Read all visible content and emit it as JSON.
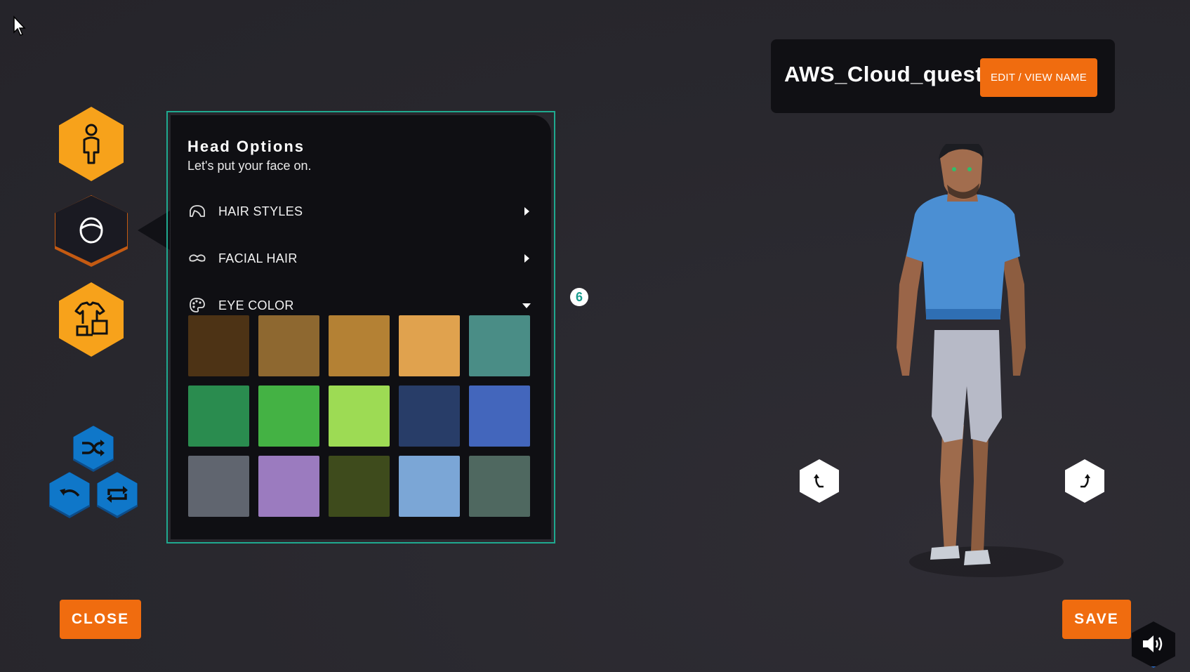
{
  "panel": {
    "title": "Head Options",
    "subtitle": "Let's put your face on.",
    "options": [
      {
        "label": "HAIR STYLES",
        "icon": "hair-icon",
        "state": "collapsed"
      },
      {
        "label": "FACIAL HAIR",
        "icon": "mustache-icon",
        "state": "collapsed"
      },
      {
        "label": "EYE COLOR",
        "icon": "palette-icon",
        "state": "expanded"
      }
    ],
    "eye_colors": [
      "#4d3315",
      "#8e6830",
      "#b48134",
      "#e0a24e",
      "#4a8d86",
      "#2a8c4f",
      "#44b244",
      "#9ddb54",
      "#283d68",
      "#4366bc",
      "#60656f",
      "#9b7bbf",
      "#3e4b1c",
      "#7ba6d6",
      "#4f6860"
    ]
  },
  "badge": {
    "value": "6"
  },
  "profile": {
    "name": "AWS_Cloud_quest",
    "edit_label": "EDIT / VIEW NAME"
  },
  "buttons": {
    "close": "CLOSE",
    "save": "SAVE"
  },
  "sidebar": [
    {
      "name": "body-category",
      "icon": "person-icon",
      "selected": false
    },
    {
      "name": "head-category",
      "icon": "head-icon",
      "selected": true
    },
    {
      "name": "outfit-category",
      "icon": "clothing-icon",
      "selected": false
    }
  ],
  "colors": {
    "accent_orange": "#f06c0f",
    "hex_orange": "#f7a21b",
    "panel_border": "#1fa98f",
    "action_blue": "#0f77c9"
  }
}
